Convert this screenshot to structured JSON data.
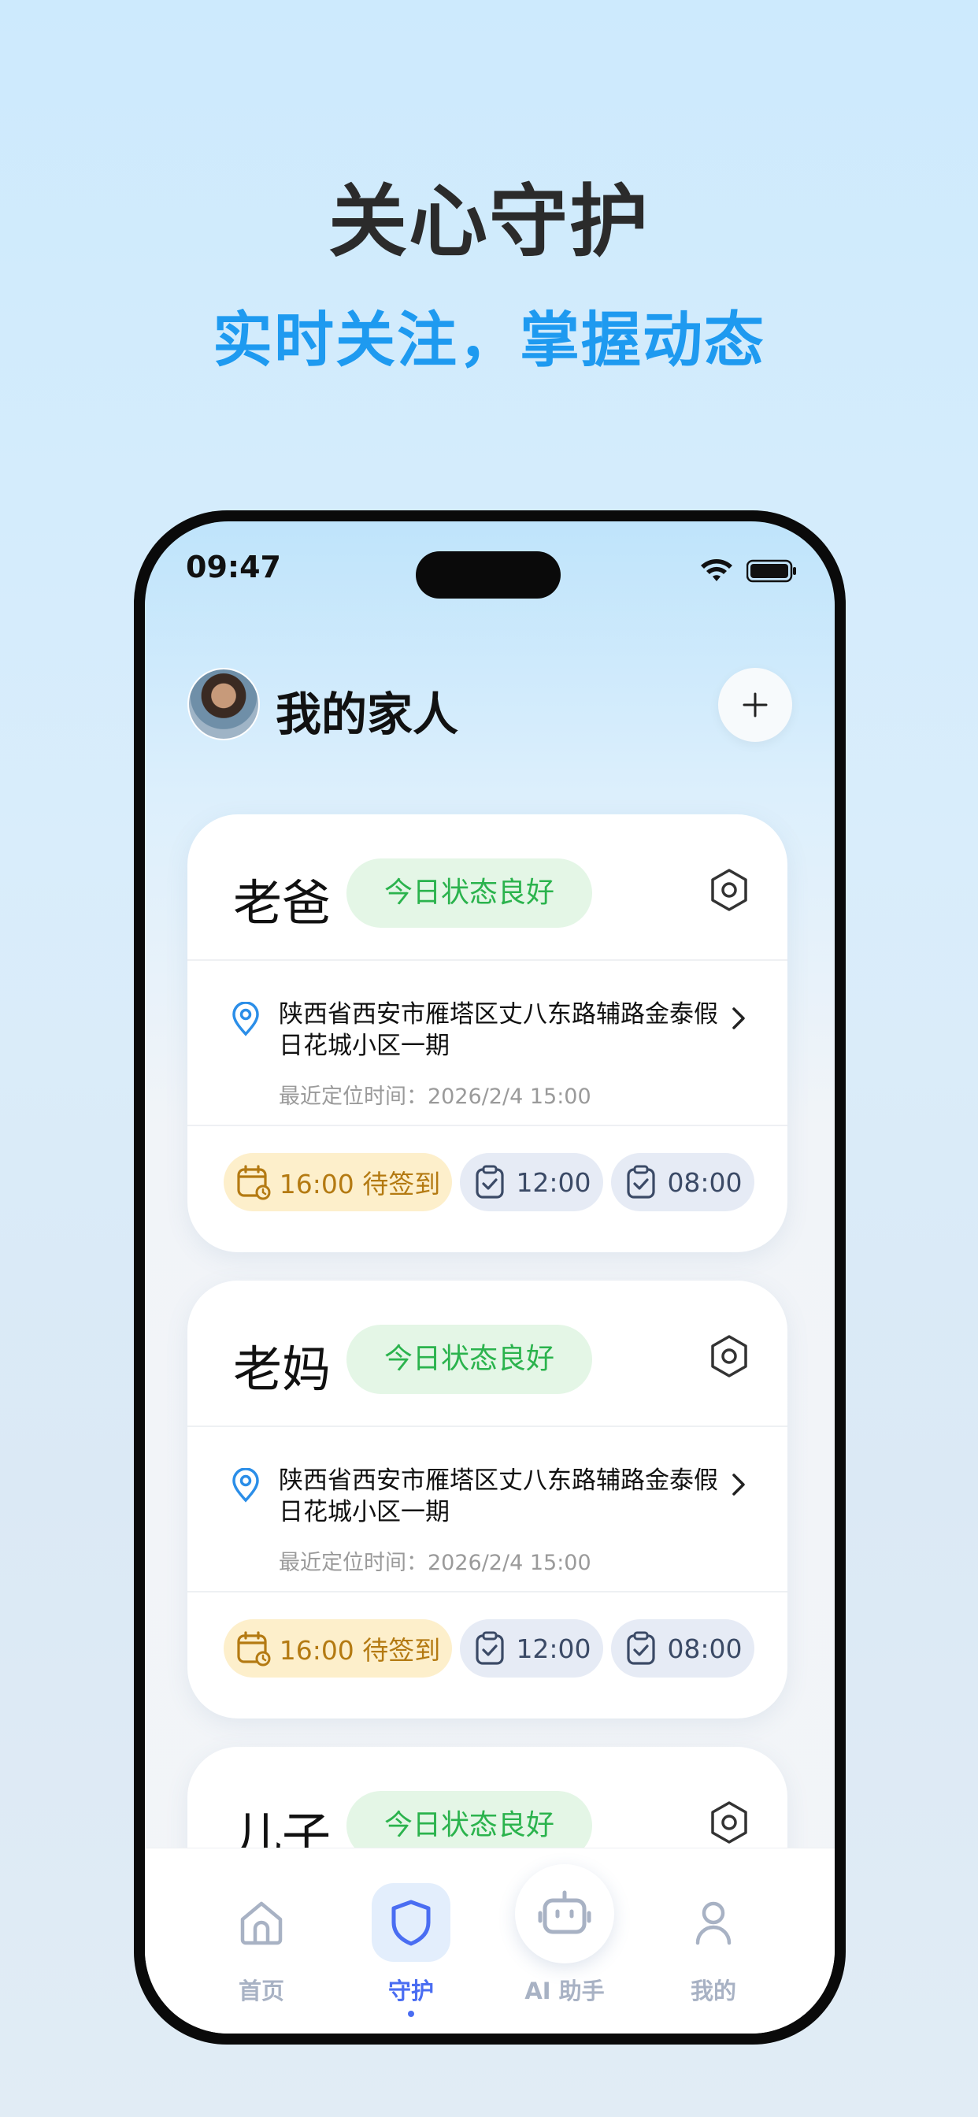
{
  "hero": {
    "title": "关心守护",
    "subtitle": "实时关注，掌握动态"
  },
  "status_bar": {
    "time": "09:47"
  },
  "header": {
    "title": "我的家人"
  },
  "cards": [
    {
      "name": "老爸",
      "status": "今日状态良好",
      "address": "陕西省西安市雁塔区丈八东路辅路金泰假日花城小区一期",
      "location_time": "最近定位时间：2026/2/4 15:00",
      "pending": "16:00 待签到",
      "done": [
        "12:00",
        "08:00"
      ]
    },
    {
      "name": "老妈",
      "status": "今日状态良好",
      "address": "陕西省西安市雁塔区丈八东路辅路金泰假日花城小区一期",
      "location_time": "最近定位时间：2026/2/4 15:00",
      "pending": "16:00 待签到",
      "done": [
        "12:00",
        "08:00"
      ]
    },
    {
      "name": "儿子",
      "status": "今日状态良好"
    }
  ],
  "tabbar": {
    "home": "首页",
    "guard": "守护",
    "ai": "AI 助手",
    "mine": "我的"
  },
  "colors": {
    "accent_blue": "#1e9af0",
    "status_green": "#2bb34d",
    "pending_amber": "#b47a12",
    "active_tab": "#4a6df2"
  }
}
